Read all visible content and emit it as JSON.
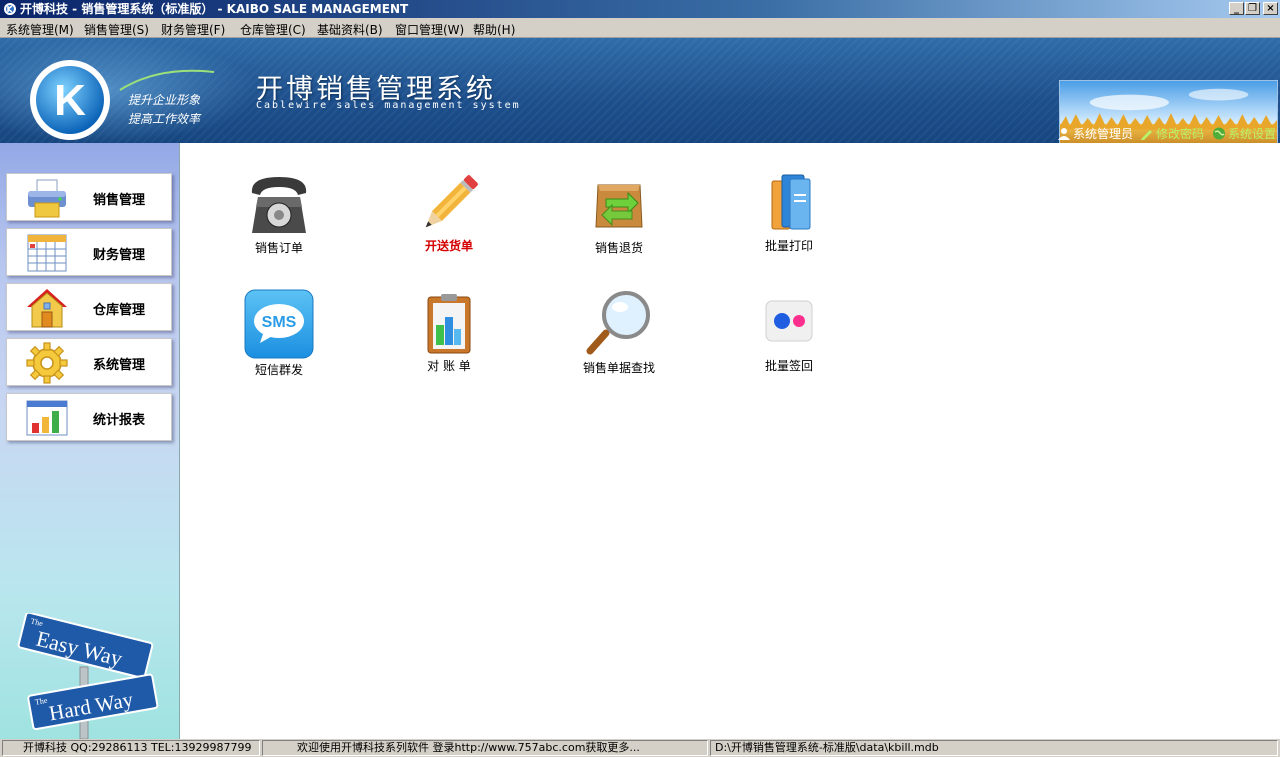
{
  "window": {
    "title": "开博科技 - 销售管理系统（标准版） - KAIBO SALE MANAGEMENT",
    "minimize": "_",
    "restore": "❐",
    "close": "×"
  },
  "menu": [
    "系统管理(M)",
    "销售管理(S)",
    "财务管理(F)",
    "仓库管理(C)",
    "基础资料(B)",
    "窗口管理(W)",
    "帮助(H)"
  ],
  "banner": {
    "logo_letter": "K",
    "slogan_line1": "提升企业形象",
    "slogan_line2": "提高工作效率",
    "title": "开博销售管理系统",
    "subtitle": "Cablewire sales management system",
    "links": {
      "user": "系统管理员",
      "change_password": "修改密码",
      "settings": "系统设置"
    }
  },
  "sidebar": {
    "items": [
      {
        "label": "销售管理",
        "icon": "printer-icon"
      },
      {
        "label": "财务管理",
        "icon": "calendar-grid-icon"
      },
      {
        "label": "仓库管理",
        "icon": "house-icon"
      },
      {
        "label": "系统管理",
        "icon": "gear-icon"
      },
      {
        "label": "统计报表",
        "icon": "bar-chart-icon"
      }
    ],
    "sign": {
      "top_small": "The",
      "top": "Easy Way",
      "bottom_small": "The",
      "bottom": "Hard Way"
    }
  },
  "tiles": [
    {
      "label": "销售订单",
      "icon": "telephone-icon",
      "highlight": false
    },
    {
      "label": "开送货单",
      "icon": "pencil-icon",
      "highlight": true
    },
    {
      "label": "销售退货",
      "icon": "return-box-icon",
      "highlight": false
    },
    {
      "label": "批量打印",
      "icon": "folders-icon",
      "highlight": false
    },
    {
      "label": "短信群发",
      "icon": "sms-icon",
      "highlight": false,
      "icon_text": "SMS"
    },
    {
      "label": "对 账 单",
      "icon": "clipboard-chart-icon",
      "highlight": false
    },
    {
      "label": "销售单据查找",
      "icon": "magnifier-icon",
      "highlight": false
    },
    {
      "label": "批量签回",
      "icon": "dots-icon",
      "highlight": false
    }
  ],
  "status": {
    "company": "开博科技 QQ:29286113 TEL:13929987799",
    "welcome": "欢迎使用开博科技系列软件   登录http://www.757abc.com获取更多...",
    "path": "D:\\开博销售管理系统-标准版\\data\\kbill.mdb"
  },
  "colors": {
    "banner": "#1d4f8c",
    "highlight_text": "#d40000",
    "link_green": "#b9f36b"
  }
}
